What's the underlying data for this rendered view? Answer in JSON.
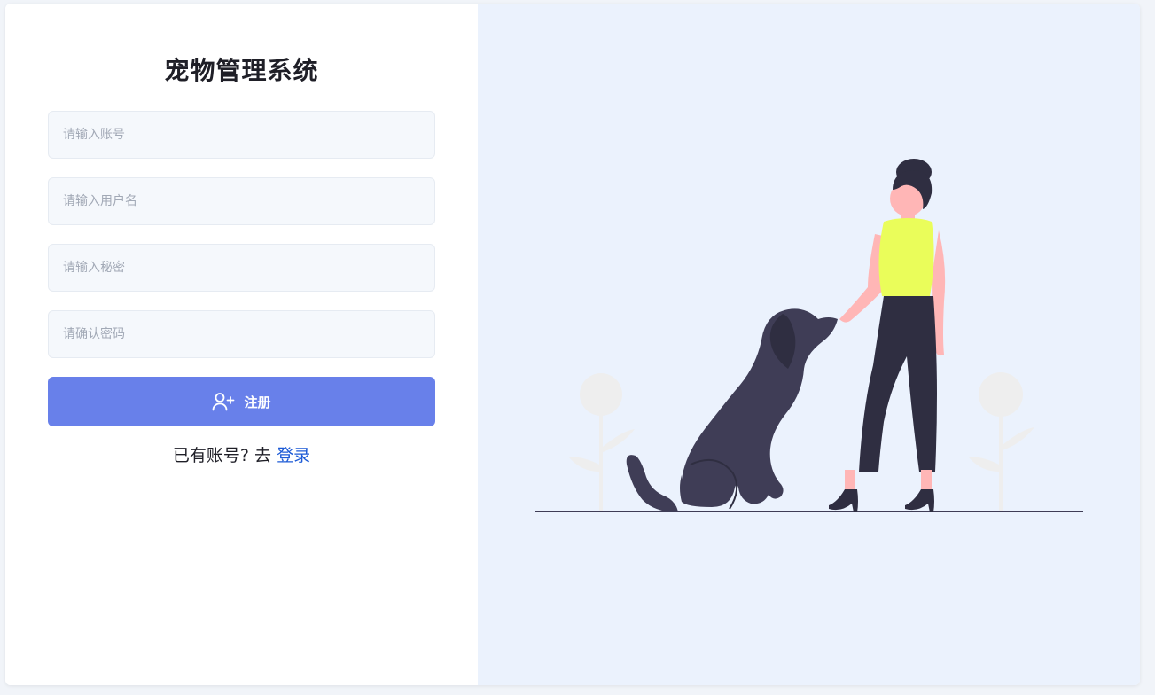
{
  "app": {
    "title": "宠物管理系统"
  },
  "form": {
    "account_placeholder": "请输入账号",
    "username_placeholder": "请输入用户名",
    "password_placeholder": "请输入秘密",
    "confirm_password_placeholder": "请确认密码",
    "register_label": "注册",
    "register_icon": "user-plus-icon",
    "have_account_text": "已有账号? 去",
    "login_link_label": "登录"
  },
  "colors": {
    "button": "#6880ea",
    "link": "#1d5bd6",
    "illustration_bg": "#ebf2fd",
    "dog": "#3f3d56",
    "pants": "#2f2e41",
    "top": "#eafd5a",
    "skin": "#ffb6b6"
  }
}
